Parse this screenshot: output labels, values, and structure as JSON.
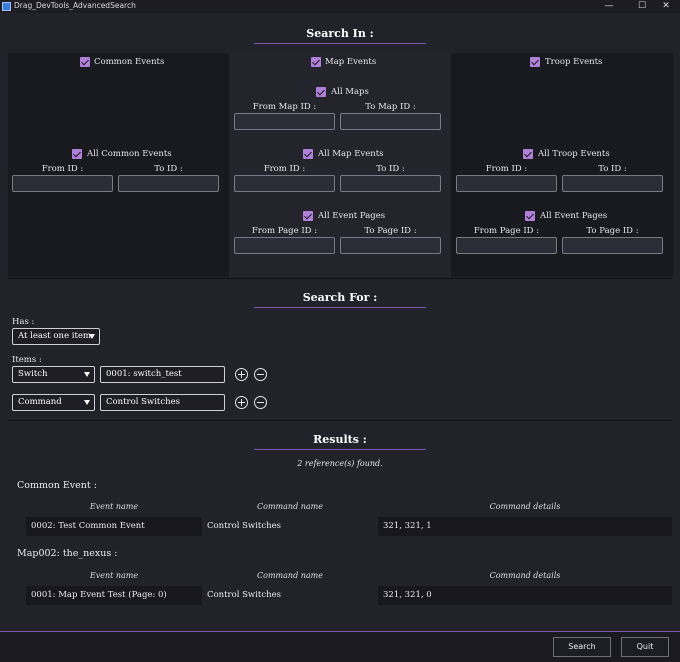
{
  "window": {
    "title": "Drag_DevTools_AdvancedSearch",
    "minimize": "—",
    "maximize": "☐",
    "close": "✕"
  },
  "search_in": {
    "heading": "Search In :",
    "common": {
      "title": "Common Events",
      "all_label": "All Common Events",
      "from_label": "From ID :",
      "to_label": "To ID :"
    },
    "map": {
      "title": "Map Events",
      "all_maps_label": "All Maps",
      "from_map_label": "From Map ID :",
      "to_map_label": "To Map ID :",
      "all_events_label": "All Map Events",
      "from_label": "From ID :",
      "to_label": "To ID :",
      "all_pages_label": "All Event Pages",
      "from_page_label": "From Page ID :",
      "to_page_label": "To Page ID :"
    },
    "troop": {
      "title": "Troop Events",
      "all_label": "All Troop Events",
      "from_label": "From ID :",
      "to_label": "To ID :",
      "all_pages_label": "All Event Pages",
      "from_page_label": "From Page ID :",
      "to_page_label": "To Page ID :"
    }
  },
  "search_for": {
    "heading": "Search For :",
    "has_label": "Has :",
    "has_value": "At least one item",
    "items_label": "Items :",
    "items": [
      {
        "type": "Switch",
        "value": "0001: switch_test"
      },
      {
        "type": "Command",
        "value": "Control Switches"
      }
    ]
  },
  "results": {
    "heading": "Results :",
    "summary": "2 reference(s) found.",
    "groups": [
      {
        "title": "Common Event :",
        "columns": [
          "Event name",
          "Command name",
          "Command details"
        ],
        "row": [
          "0002: Test Common Event",
          "Control Switches",
          "321, 321, 1"
        ]
      },
      {
        "title": "Map002: the_nexus :",
        "columns": [
          "Event name",
          "Command name",
          "Command details"
        ],
        "row": [
          "0001: Map Event Test (Page: 0)",
          "Control Switches",
          "321, 321, 0"
        ]
      }
    ]
  },
  "footer": {
    "search_label": "Search",
    "quit_label": "Quit"
  },
  "colors": {
    "accent": "#b07fd8",
    "background": "#22222b",
    "panel": "#191920"
  }
}
